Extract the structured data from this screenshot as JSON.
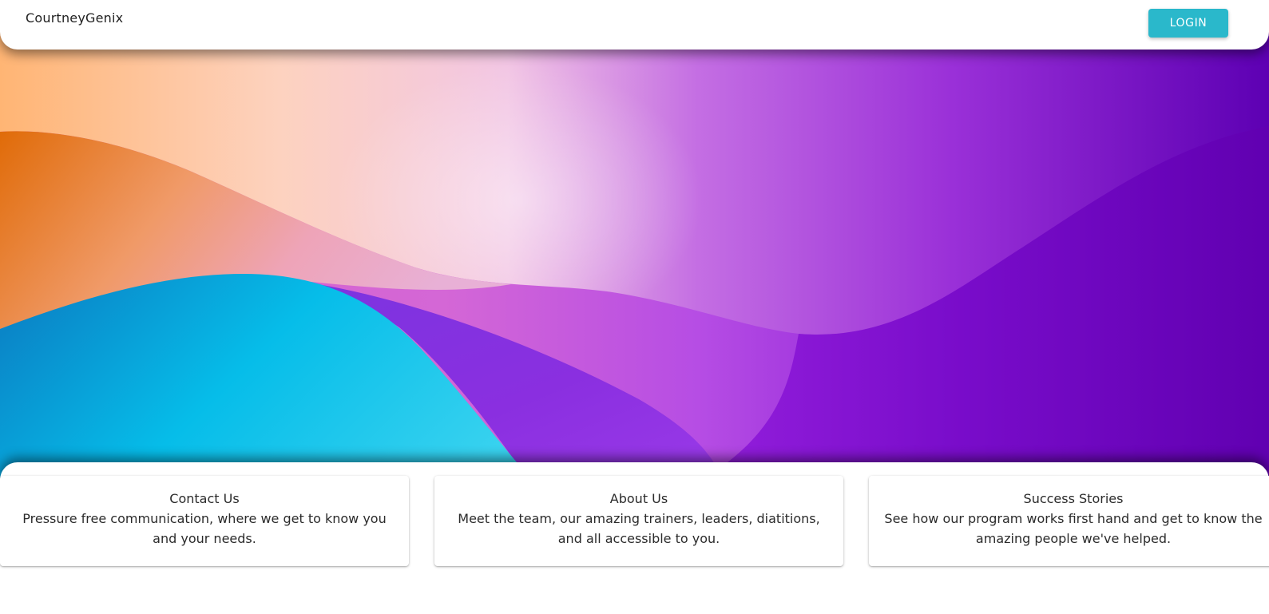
{
  "navbar": {
    "brand": "CourtneyGenix",
    "login_label": "LOGIN"
  },
  "colors": {
    "accent": "#2ab8cb",
    "hero_orange": "#e2730f",
    "hero_peach": "#ffc48a",
    "hero_pink": "#f4c7dc",
    "hero_purple": "#8a1fd8",
    "hero_deep_purple": "#5a00b0",
    "hero_cyan": "#1fc5ea"
  },
  "cards": [
    {
      "title": "Contact Us",
      "text": "Pressure free communication, where we get to know you and your needs."
    },
    {
      "title": "About Us",
      "text": "Meet the team, our amazing trainers, leaders, diatitions, and all accessible to you."
    },
    {
      "title": "Success Stories",
      "text": "See how our program works first hand and get to know the amazing people we've helped."
    }
  ]
}
